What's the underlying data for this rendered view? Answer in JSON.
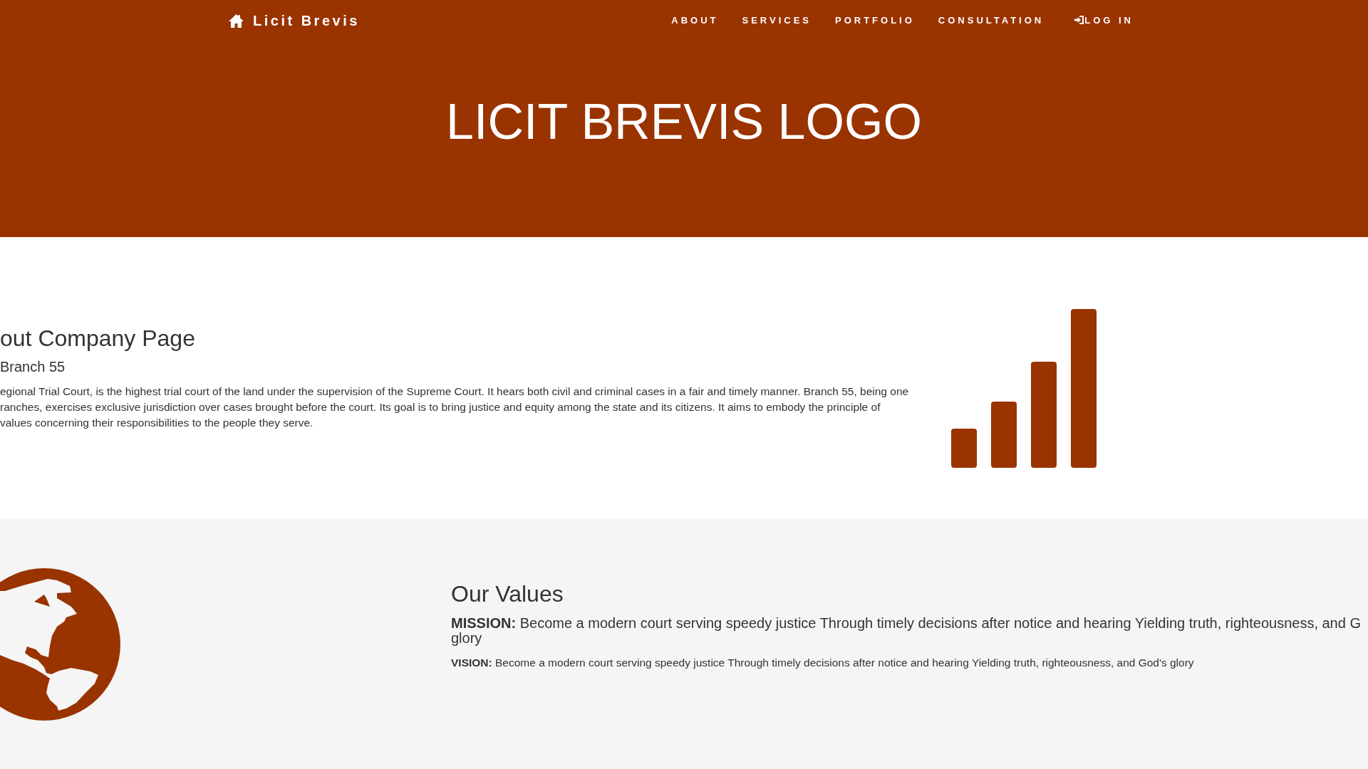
{
  "navbar": {
    "brand": "Licit Brevis",
    "links": [
      {
        "label": "ABOUT",
        "kind": "text"
      },
      {
        "label": "SERVICES",
        "kind": "text"
      },
      {
        "label": "PORTFOLIO",
        "kind": "text"
      },
      {
        "label": "CONSULTATION",
        "kind": "text"
      },
      {
        "label": "LOG IN",
        "kind": "login"
      }
    ]
  },
  "hero": {
    "title": "LICIT BREVIS LOGO"
  },
  "about": {
    "heading": "out Company Page",
    "subheading": "Branch 55",
    "body": "egional Trial Court, is the highest trial court of the land under the supervision of the Supreme Court. It hears both civil and criminal cases in a fair and timely manner. Branch 55, being one\nranches, exercises exclusive jurisdiction over cases brought before the court. Its goal is to bring justice and equity among the state and its citizens. It aims to embody the principle of\nvalues concerning their responsibilities to the people they serve."
  },
  "values": {
    "heading": "Our Values",
    "mission": "**MISSION:** Become a modern court serving speedy justice Through timely decisions after notice and hearing Yielding truth, righteousness, and G\nglory",
    "vision": "**VISION:** Become a modern court serving speedy justice Through timely decisions after notice and hearing Yielding truth, righteousness, and God's glory"
  }
}
